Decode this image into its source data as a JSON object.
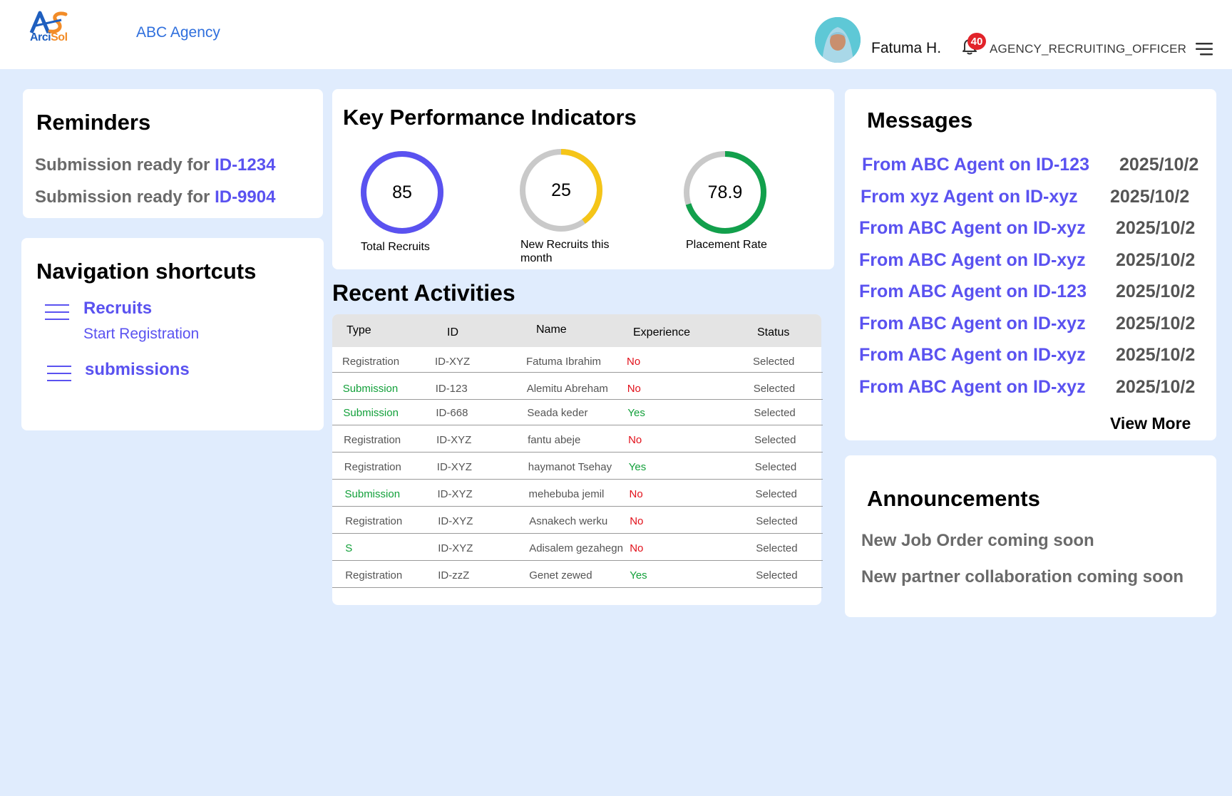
{
  "header": {
    "logo_initials": "AS",
    "logo_brand_a": "Arci",
    "logo_brand_b": "Sol",
    "agency_name": "ABC Agency",
    "user_name": "Fatuma H.",
    "notification_count": "40",
    "role": "AGENCY_RECRUITING_OFFICER"
  },
  "reminders": {
    "title": "Reminders",
    "items": [
      {
        "text": "Submission ready for ",
        "id": "ID-1234"
      },
      {
        "text": "Submission ready for ",
        "id": "ID-9904"
      }
    ]
  },
  "navigation": {
    "title": "Navigation shortcuts",
    "items": [
      {
        "label": "Recruits",
        "sub": "Start Registration"
      },
      {
        "label": "submissions"
      }
    ]
  },
  "kpi": {
    "title": "Key Performance Indicators",
    "items": [
      {
        "value": "85",
        "label": "Total Recruits",
        "fraction": 1.0,
        "color": "#5a52f0"
      },
      {
        "value": "25",
        "label": "New Recruits this month",
        "fraction": 0.4,
        "color": "#f5c518"
      },
      {
        "value": "78.9",
        "label": "Placement Rate",
        "fraction": 0.7,
        "color": "#12a04c"
      }
    ]
  },
  "activities": {
    "title": "Recent Activities",
    "columns": [
      "Type",
      "ID",
      "Name",
      "Experience",
      "Status"
    ],
    "rows": [
      {
        "type": "Registration",
        "id": "ID-XYZ",
        "name": "Fatuma Ibrahim",
        "experience": "No",
        "status": "Selected"
      },
      {
        "type": "Submission",
        "id": "ID-123",
        "name": "Alemitu Abreham",
        "experience": "No",
        "status": "Selected"
      },
      {
        "type": "Submission",
        "id": "ID-668",
        "name": "Seada keder",
        "experience": "Yes",
        "status": "Selected"
      },
      {
        "type": "Registration",
        "id": "ID-XYZ",
        "name": "fantu abeje",
        "experience": "No",
        "status": "Selected"
      },
      {
        "type": "Registration",
        "id": "ID-XYZ",
        "name": "haymanot Tsehay",
        "experience": "Yes",
        "status": "Selected"
      },
      {
        "type": "Submission",
        "id": "ID-XYZ",
        "name": "mehebuba jemil",
        "experience": "No",
        "status": "Selected"
      },
      {
        "type": "Registration",
        "id": "ID-XYZ",
        "name": "Asnakech werku",
        "experience": "No",
        "status": "Selected"
      },
      {
        "type": "S",
        "id": "ID-XYZ",
        "name": "Adisalem gezahegn",
        "experience": "No",
        "status": "Selected"
      },
      {
        "type": "Registration",
        "id": "ID-zzZ",
        "name": "Genet zewed",
        "experience": "Yes",
        "status": "Selected"
      }
    ]
  },
  "messages": {
    "title": "Messages",
    "items": [
      {
        "from": "From ABC Agent on ID-123",
        "date": "2025/10/2"
      },
      {
        "from": "From xyz Agent on ID-xyz",
        "date": "2025/10/2"
      },
      {
        "from": "From ABC Agent on ID-xyz",
        "date": "2025/10/2"
      },
      {
        "from": "From ABC Agent on ID-xyz",
        "date": "2025/10/2"
      },
      {
        "from": "From ABC Agent on ID-123",
        "date": "2025/10/2"
      },
      {
        "from": "From ABC Agent on ID-xyz",
        "date": "2025/10/2"
      },
      {
        "from": "From ABC Agent on ID-xyz",
        "date": "2025/10/2"
      },
      {
        "from": "From ABC Agent on ID-xyz",
        "date": "2025/10/2"
      }
    ],
    "view_more": "View More"
  },
  "announcements": {
    "title": "Announcements",
    "items": [
      "New Job Order coming soon",
      "New partner collaboration coming soon"
    ]
  },
  "icons": {
    "logo": "arcisol-logo-icon",
    "bell": "bell-icon",
    "menu": "hamburger-menu-icon",
    "nav": "list-icon"
  },
  "colors": {
    "page_bg": "#e0ecfd",
    "accent": "#5a52f0",
    "link_blue": "#2f6fdd",
    "success": "#12a03a",
    "danger": "#e2101a",
    "warning": "#f5c518"
  }
}
